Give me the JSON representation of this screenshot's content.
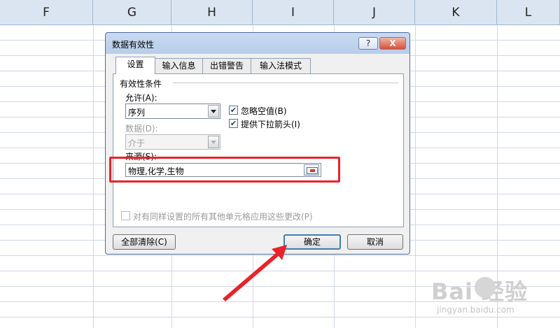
{
  "sheet": {
    "columns": [
      "F",
      "G",
      "H",
      "I",
      "J",
      "K",
      "L"
    ]
  },
  "dialog": {
    "title": "数据有效性",
    "help_label": "?",
    "close_label": "X",
    "tabs": [
      "设置",
      "输入信息",
      "出错警告",
      "输入法模式"
    ],
    "active_tab": "设置",
    "validity_group_label": "有效性条件",
    "allow_label": "允许(A):",
    "allow_value": "序列",
    "data_label": "数据(D):",
    "data_value": "介于",
    "ignore_blank_label": "忽略空值(B)",
    "ignore_blank_checked": true,
    "dropdown_label": "提供下拉箭头(I)",
    "dropdown_checked": true,
    "source_label": "来源(S):",
    "source_value": "物理,化学,生物",
    "apply_all_label": "对有同样设置的所有其他单元格应用这些更改(P)",
    "apply_all_checked": false,
    "clear_all_label": "全部清除(C)",
    "ok_label": "确定",
    "cancel_label": "取消"
  },
  "annotation": {
    "highlight_color": "#e8232a"
  },
  "watermark": {
    "logo_text": "Bai  经验",
    "url_text": "jingyan.baidu.com"
  }
}
